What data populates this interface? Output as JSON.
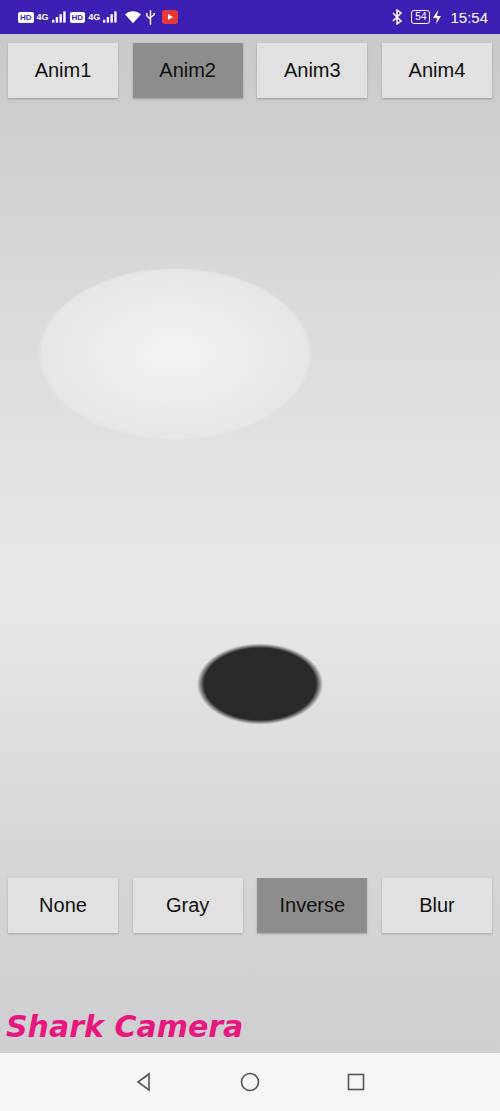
{
  "status_bar": {
    "network_left": "HD",
    "network_right": "HD",
    "signal_1": "4G",
    "signal_2": "4G",
    "battery": "54",
    "time": "15:54"
  },
  "animations": [
    {
      "label": "Anim1",
      "selected": false
    },
    {
      "label": "Anim2",
      "selected": true
    },
    {
      "label": "Anim3",
      "selected": false
    },
    {
      "label": "Anim4",
      "selected": false
    }
  ],
  "filters": [
    {
      "label": "None",
      "selected": false
    },
    {
      "label": "Gray",
      "selected": false
    },
    {
      "label": "Inverse",
      "selected": true
    },
    {
      "label": "Blur",
      "selected": false
    }
  ],
  "title": "Shark Camera"
}
